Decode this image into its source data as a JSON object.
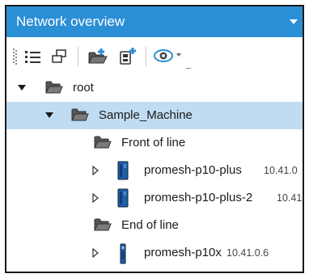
{
  "panel": {
    "title": "Network overview"
  },
  "toolbar": {
    "icons": [
      "list-view-icon",
      "group-icon",
      "add-folder-icon",
      "add-device-icon",
      "view-options-icon"
    ]
  },
  "tree": {
    "root": {
      "label": "root"
    },
    "machine": {
      "label": "Sample_Machine"
    },
    "front": {
      "label": "Front of line"
    },
    "device1": {
      "label": "promesh-p10-plus",
      "ip": "10.41.0"
    },
    "device2": {
      "label": "promesh-p10-plus-2",
      "ip": "10.41"
    },
    "end": {
      "label": "End of line"
    },
    "device3": {
      "label": "promesh-p10x",
      "ip": "10.41.0.6"
    }
  },
  "colors": {
    "header": "#2b8fd6",
    "selected_row": "#bfdcf2",
    "device": "#1f5fa8"
  }
}
